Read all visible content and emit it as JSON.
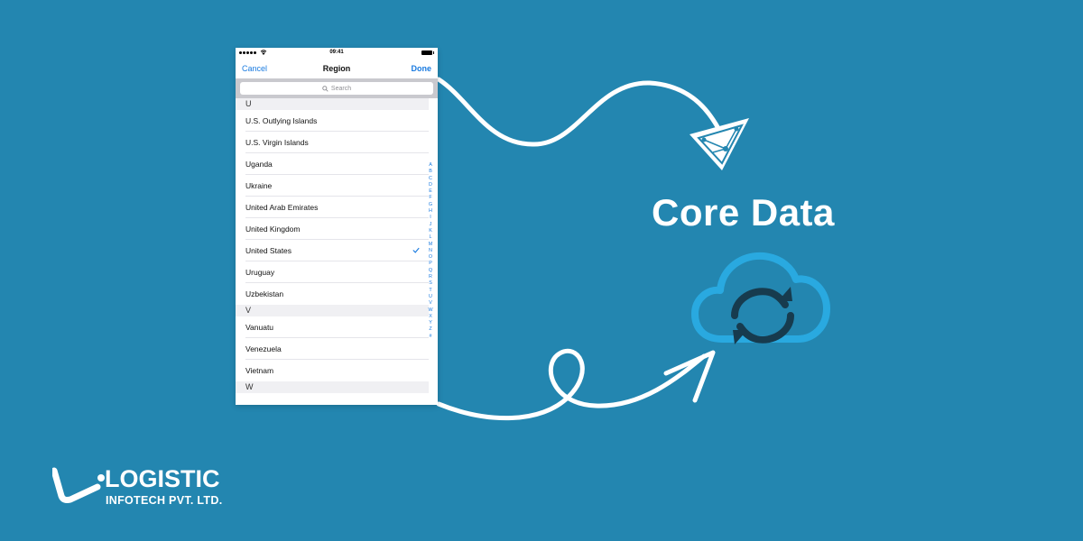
{
  "phone": {
    "status_time": "09:41",
    "nav": {
      "cancel": "Cancel",
      "title": "Region",
      "done": "Done"
    },
    "search_placeholder": "Search",
    "sections": [
      {
        "letter": "U",
        "items": [
          "U.S. Outlying Islands",
          "U.S. Virgin Islands",
          "Uganda",
          "Ukraine",
          "United Arab Emirates",
          "United Kingdom",
          "United States",
          "Uruguay",
          "Uzbekistan"
        ]
      },
      {
        "letter": "V",
        "items": [
          "Vanuatu",
          "Venezuela",
          "Vietnam"
        ]
      },
      {
        "letter": "W",
        "items": []
      }
    ],
    "selected_item": "United States",
    "index_letters": [
      "A",
      "B",
      "C",
      "D",
      "E",
      "F",
      "G",
      "H",
      "I",
      "J",
      "K",
      "L",
      "M",
      "N",
      "O",
      "P",
      "Q",
      "R",
      "S",
      "T",
      "U",
      "V",
      "W",
      "X",
      "Y",
      "Z",
      "#"
    ]
  },
  "headline": "Core Data",
  "brand": {
    "name": "LOGISTIC",
    "tagline": "INFOTECH PVT. LTD."
  },
  "colors": {
    "background": "#2386b0",
    "accent": "#1a7be0",
    "cloud": "#29a9e0",
    "sync_arrows": "#173b4e"
  },
  "icons": [
    "signal-icon",
    "wifi-icon",
    "battery-icon",
    "search-icon",
    "checkmark-icon",
    "core-data-logo-icon",
    "cloud-sync-icon",
    "logistic-logo-icon"
  ]
}
